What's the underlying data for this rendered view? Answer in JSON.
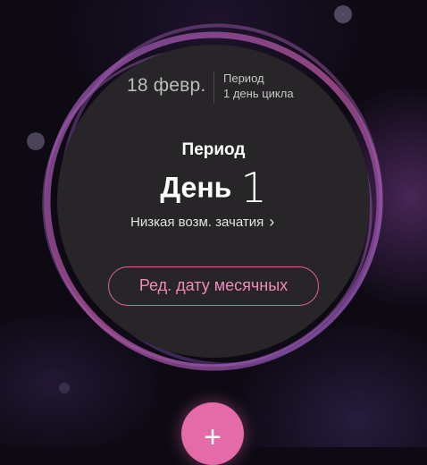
{
  "header": {
    "date": "18 февр.",
    "phase_name": "Период",
    "cycle_day_text": "1 день цикла"
  },
  "circle": {
    "phase_label": "Период",
    "day_word": "День",
    "day_number": "1",
    "fertility_text": "Низкая возм. зачатия",
    "edit_button_label": "Ред. дату месячных"
  },
  "fab": {
    "symbol": "+"
  },
  "colors": {
    "accent": "#e46aa8",
    "button_border": "#e0649f",
    "disc": "#282529",
    "background": "#0d0a14"
  }
}
